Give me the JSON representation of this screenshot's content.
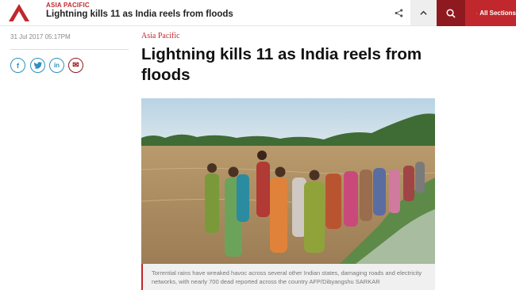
{
  "header": {
    "section": "ASIA PACIFIC",
    "title": "Lightning kills 11 as India reels from floods",
    "logo_icon": "cna-logo-icon",
    "share_icon": "share-icon",
    "up_icon": "chevron-up-icon",
    "search_icon": "search-icon",
    "menu_icon": "hamburger-menu-icon",
    "menu_label": "All Sections",
    "colors": {
      "brand_red": "#c0282d",
      "dark_red": "#8e1a1f"
    }
  },
  "sidebar": {
    "date": "31 Jul 2017 05:17PM",
    "share_buttons": [
      {
        "icon": "facebook-icon",
        "glyph": "f"
      },
      {
        "icon": "twitter-icon",
        "glyph": "t"
      },
      {
        "icon": "linkedin-icon",
        "glyph": "in"
      },
      {
        "icon": "email-icon",
        "glyph": "✉"
      }
    ]
  },
  "article": {
    "kicker": "Asia Pacific",
    "headline": "Lightning kills 11 as India reels from floods",
    "caption": "Torrential rains have wreaked havoc across several other Indian states, damaging roads and electricity networks, with nearly 700 dead reported across the country AFP/Dibyangshu SARKAR"
  }
}
